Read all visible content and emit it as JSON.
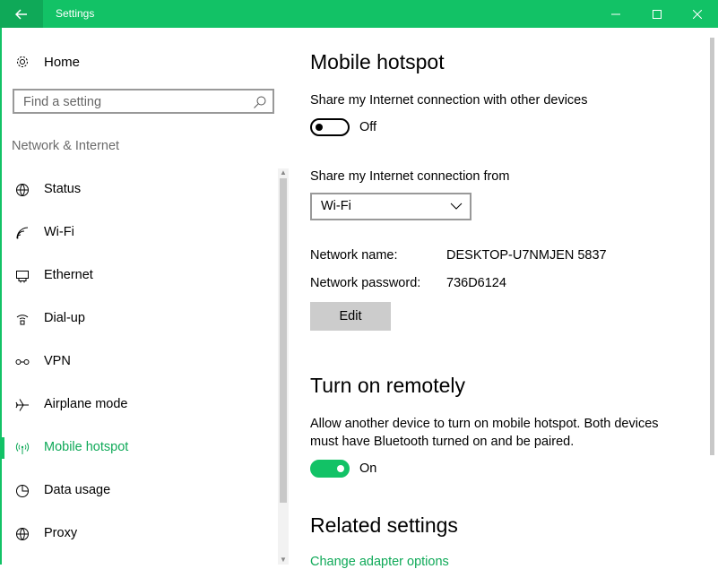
{
  "window": {
    "title": "Settings",
    "back_icon": "arrow-left-icon",
    "minimize_icon": "minimize-icon",
    "maximize_icon": "maximize-icon",
    "close_icon": "close-icon",
    "accent_color": "#12c266"
  },
  "sidebar": {
    "home_label": "Home",
    "home_icon": "gear-icon",
    "search_placeholder": "Find a setting",
    "search_icon": "search-icon",
    "section_label": "Network & Internet",
    "items": [
      {
        "label": "Status",
        "icon": "globe-icon"
      },
      {
        "label": "Wi-Fi",
        "icon": "wifi-icon"
      },
      {
        "label": "Ethernet",
        "icon": "ethernet-icon"
      },
      {
        "label": "Dial-up",
        "icon": "dialup-icon"
      },
      {
        "label": "VPN",
        "icon": "vpn-icon"
      },
      {
        "label": "Airplane mode",
        "icon": "airplane-icon"
      },
      {
        "label": "Mobile hotspot",
        "icon": "hotspot-icon",
        "active": true
      },
      {
        "label": "Data usage",
        "icon": "pie-chart-icon"
      },
      {
        "label": "Proxy",
        "icon": "globe-icon"
      }
    ]
  },
  "main": {
    "title": "Mobile hotspot",
    "share_label": "Share my Internet connection with other devices",
    "share_toggle_state": "Off",
    "share_from_label": "Share my Internet connection from",
    "share_from_value": "Wi-Fi",
    "network_name_label": "Network name:",
    "network_name_value": "DESKTOP-U7NMJEN 5837",
    "network_password_label": "Network password:",
    "network_password_value": "736D6124",
    "edit_label": "Edit",
    "remote_title": "Turn on remotely",
    "remote_desc_line1": "Allow another device to turn on mobile hotspot. Both devices",
    "remote_desc_line2": "must have Bluetooth turned on and be paired.",
    "remote_toggle_state": "On",
    "related_title": "Related settings",
    "related_link": "Change adapter options"
  }
}
